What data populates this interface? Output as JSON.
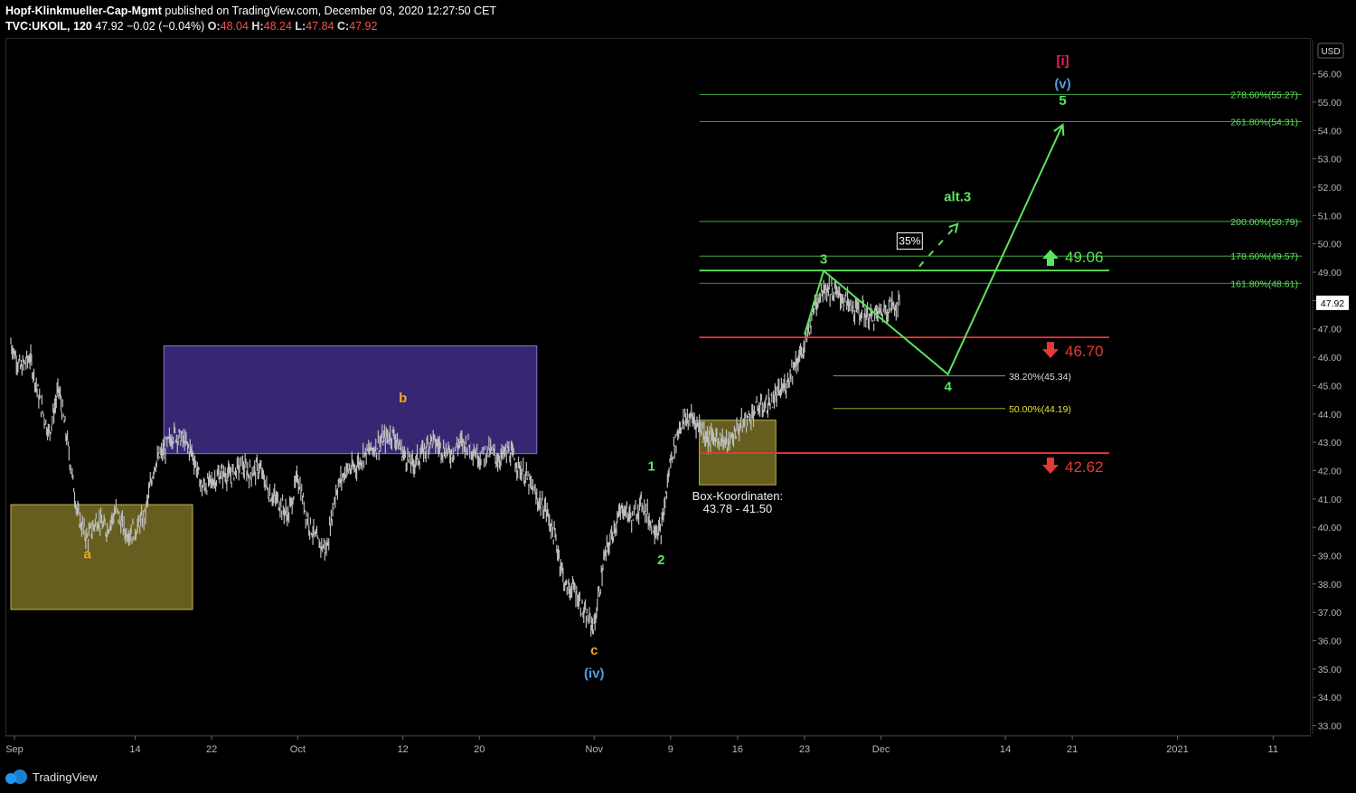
{
  "header": {
    "author": "Hopf-Klinkmueller-Cap-Mgmt",
    "published": "published on TradingView.com, December 03, 2020 12:27:50 CET",
    "symbol": "TVC:UKOIL, 120",
    "last": "47.92",
    "change": "−0.02 (−0.04%)",
    "o_label": "O:",
    "o_value": "48.04",
    "h_label": "H:",
    "h_value": "48.24",
    "l_label": "L:",
    "l_value": "47.84",
    "c_label": "C:",
    "c_value": "47.92"
  },
  "footer": {
    "brand": "TradingView"
  },
  "colors": {
    "background": "#000000",
    "candle": "#bdbdbd",
    "wave_green": "#5ee35e",
    "red_line": "#e53935",
    "orange": "#f5a623",
    "blue": "#4f9fe8",
    "magenta": "#e91e63",
    "olive_box": "#6b6420",
    "purple_box": "#3a2a7a"
  },
  "chart_data": {
    "type": "candlestick",
    "symbol": "TVC:UKOIL",
    "currency": "USD",
    "last_price": 47.92,
    "y_range": [
      32.7,
      57.2
    ],
    "y_ticks": [
      33,
      34,
      35,
      36,
      37,
      38,
      39,
      40,
      41,
      42,
      43,
      44,
      45,
      46,
      47,
      48,
      49,
      50,
      51,
      52,
      53,
      54,
      55,
      56
    ],
    "x_range": [
      "2020-09-01",
      "2021-01-14"
    ],
    "x_ticks": [
      {
        "label": "Sep",
        "date": "2020-09-01"
      },
      {
        "label": "14",
        "date": "2020-09-14"
      },
      {
        "label": "22",
        "date": "2020-09-22"
      },
      {
        "label": "Oct",
        "date": "2020-10-01"
      },
      {
        "label": "12",
        "date": "2020-10-12"
      },
      {
        "label": "20",
        "date": "2020-10-20"
      },
      {
        "label": "Nov",
        "date": "2020-11-01"
      },
      {
        "label": "9",
        "date": "2020-11-09"
      },
      {
        "label": "16",
        "date": "2020-11-16"
      },
      {
        "label": "23",
        "date": "2020-11-23"
      },
      {
        "label": "Dec",
        "date": "2020-12-01"
      },
      {
        "label": "14",
        "date": "2020-12-14"
      },
      {
        "label": "21",
        "date": "2020-12-21"
      },
      {
        "label": "2021",
        "date": "2021-01-01"
      },
      {
        "label": "11",
        "date": "2021-01-11"
      }
    ],
    "price_path": [
      [
        "2020-09-01",
        46.5
      ],
      [
        "2020-09-02",
        45.6
      ],
      [
        "2020-09-03",
        46.0
      ],
      [
        "2020-09-04",
        44.5
      ],
      [
        "2020-09-05",
        43.3
      ],
      [
        "2020-09-06",
        44.9
      ],
      [
        "2020-09-07",
        42.8
      ],
      [
        "2020-09-08",
        40.4
      ],
      [
        "2020-09-09",
        39.6
      ],
      [
        "2020-09-10",
        40.3
      ],
      [
        "2020-09-11",
        39.9
      ],
      [
        "2020-09-12",
        40.6
      ],
      [
        "2020-09-13",
        39.8
      ],
      [
        "2020-09-14",
        39.9
      ],
      [
        "2020-09-15",
        40.4
      ],
      [
        "2020-09-16",
        42.2
      ],
      [
        "2020-09-17",
        42.7
      ],
      [
        "2020-09-18",
        43.3
      ],
      [
        "2020-09-19",
        43.1
      ],
      [
        "2020-09-20",
        42.6
      ],
      [
        "2020-09-21",
        41.4
      ],
      [
        "2020-09-22",
        41.6
      ],
      [
        "2020-09-23",
        41.9
      ],
      [
        "2020-09-24",
        41.8
      ],
      [
        "2020-09-25",
        42.2
      ],
      [
        "2020-09-26",
        41.9
      ],
      [
        "2020-09-27",
        42.1
      ],
      [
        "2020-09-28",
        41.2
      ],
      [
        "2020-09-29",
        40.9
      ],
      [
        "2020-09-30",
        40.4
      ],
      [
        "2020-10-01",
        41.8
      ],
      [
        "2020-10-02",
        40.3
      ],
      [
        "2020-10-03",
        39.5
      ],
      [
        "2020-10-04",
        39.2
      ],
      [
        "2020-10-05",
        41.3
      ],
      [
        "2020-10-06",
        42.0
      ],
      [
        "2020-10-07",
        42.1
      ],
      [
        "2020-10-08",
        42.6
      ],
      [
        "2020-10-09",
        42.8
      ],
      [
        "2020-10-10",
        43.1
      ],
      [
        "2020-10-11",
        43.3
      ],
      [
        "2020-10-12",
        42.6
      ],
      [
        "2020-10-13",
        42.2
      ],
      [
        "2020-10-14",
        42.6
      ],
      [
        "2020-10-15",
        43.1
      ],
      [
        "2020-10-16",
        42.8
      ],
      [
        "2020-10-17",
        42.6
      ],
      [
        "2020-10-18",
        43.0
      ],
      [
        "2020-10-19",
        42.9
      ],
      [
        "2020-10-20",
        42.5
      ],
      [
        "2020-10-21",
        42.7
      ],
      [
        "2020-10-22",
        42.4
      ],
      [
        "2020-10-23",
        42.7
      ],
      [
        "2020-10-24",
        42.2
      ],
      [
        "2020-10-25",
        41.7
      ],
      [
        "2020-10-26",
        41.0
      ],
      [
        "2020-10-27",
        40.6
      ],
      [
        "2020-10-28",
        39.5
      ],
      [
        "2020-10-29",
        37.9
      ],
      [
        "2020-10-30",
        37.8
      ],
      [
        "2020-10-31",
        36.9
      ],
      [
        "2020-11-01",
        36.5
      ],
      [
        "2020-11-02",
        38.8
      ],
      [
        "2020-11-03",
        39.9
      ],
      [
        "2020-11-04",
        40.7
      ],
      [
        "2020-11-05",
        40.3
      ],
      [
        "2020-11-06",
        40.9
      ],
      [
        "2020-11-07",
        40.1
      ],
      [
        "2020-11-08",
        39.8
      ],
      [
        "2020-11-09",
        42.4
      ],
      [
        "2020-11-10",
        43.6
      ],
      [
        "2020-11-11",
        43.9
      ],
      [
        "2020-11-12",
        43.6
      ],
      [
        "2020-11-13",
        43.1
      ],
      [
        "2020-11-14",
        43.2
      ],
      [
        "2020-11-15",
        42.9
      ],
      [
        "2020-11-16",
        43.5
      ],
      [
        "2020-11-17",
        43.8
      ],
      [
        "2020-11-18",
        44.2
      ],
      [
        "2020-11-19",
        44.3
      ],
      [
        "2020-11-20",
        44.6
      ],
      [
        "2020-11-21",
        45.0
      ],
      [
        "2020-11-22",
        45.8
      ],
      [
        "2020-11-23",
        46.3
      ],
      [
        "2020-11-24",
        47.8
      ],
      [
        "2020-11-25",
        48.5
      ],
      [
        "2020-11-26",
        48.3
      ],
      [
        "2020-11-27",
        48.1
      ],
      [
        "2020-11-28",
        47.7
      ],
      [
        "2020-11-29",
        47.6
      ],
      [
        "2020-11-30",
        47.4
      ],
      [
        "2020-12-01",
        47.6
      ],
      [
        "2020-12-02",
        47.8
      ],
      [
        "2020-12-03",
        47.92
      ]
    ],
    "boxes": [
      {
        "name": "wave-a-box",
        "x": [
          "2020-09-01",
          "2020-09-20"
        ],
        "y": [
          37.1,
          40.8
        ],
        "color": "#6b6420"
      },
      {
        "name": "wave-b-box",
        "x": [
          "2020-09-17",
          "2020-10-26"
        ],
        "y": [
          42.6,
          46.4
        ],
        "color": "#3a2a7a"
      },
      {
        "name": "koordinaten-box",
        "x": [
          "2020-11-12",
          "2020-11-20"
        ],
        "y": [
          41.5,
          43.78
        ],
        "color": "#6b6420"
      }
    ],
    "box_label": {
      "line1": "Box-Koordinaten:",
      "line2": "43.78 - 41.50"
    },
    "fib_levels": [
      {
        "label": "278.60%(55.27)",
        "price": 55.27,
        "color": "#5ee35e",
        "x_start": "2020-11-12"
      },
      {
        "label": "261.80%(54.31)",
        "price": 54.31,
        "color": "#5ee35e",
        "x_start": "2020-11-12"
      },
      {
        "label": "200.00%(50.79)",
        "price": 50.79,
        "color": "#5ee35e",
        "x_start": "2020-11-12"
      },
      {
        "label": "178.60%(49.57)",
        "price": 49.57,
        "color": "#5ee35e",
        "x_start": "2020-11-12"
      },
      {
        "label": "161.80%(48.61)",
        "price": 48.61,
        "color": "#5ee35e",
        "x_start": "2020-11-12"
      },
      {
        "label": "38.20%(45.34)",
        "price": 45.34,
        "color": "#dddddd",
        "x_start": "2020-11-26"
      },
      {
        "label": "50.00%(44.19)",
        "price": 44.19,
        "color": "#e6e637",
        "x_start": "2020-11-26"
      }
    ],
    "levels": [
      {
        "price": 49.06,
        "label": "49.06",
        "direction": "up",
        "color": "#5ee35e"
      },
      {
        "price": 46.7,
        "label": "46.70",
        "direction": "down",
        "color": "#e53935"
      },
      {
        "price": 42.62,
        "label": "42.62",
        "direction": "down",
        "color": "#e53935"
      }
    ],
    "wave_path": [
      [
        "2020-11-23",
        46.8
      ],
      [
        "2020-11-25",
        49.05
      ],
      [
        "2020-12-08",
        45.4
      ],
      [
        "2020-12-20",
        54.2
      ]
    ],
    "alt_path": [
      [
        "2020-12-05",
        49.2
      ],
      [
        "2020-12-09",
        50.7
      ]
    ],
    "wave_labels": [
      {
        "text": "a",
        "date": "2020-09-09",
        "price": 38.9,
        "color": "#f5a623"
      },
      {
        "text": "b",
        "date": "2020-10-12",
        "price": 44.4,
        "color": "#f5a623"
      },
      {
        "text": "c",
        "date": "2020-11-01",
        "price": 35.5,
        "color": "#f5a623"
      },
      {
        "text": "(iv)",
        "date": "2020-11-01",
        "price": 34.7,
        "color": "#4f9fe8"
      },
      {
        "text": "1",
        "date": "2020-11-07",
        "price": 42.0,
        "color": "#5ee35e"
      },
      {
        "text": "2",
        "date": "2020-11-08",
        "price": 38.7,
        "color": "#5ee35e"
      },
      {
        "text": "3",
        "date": "2020-11-25",
        "price": 49.3,
        "color": "#5ee35e"
      },
      {
        "text": "4",
        "date": "2020-12-08",
        "price": 44.8,
        "color": "#5ee35e"
      },
      {
        "text": "5",
        "date": "2020-12-20",
        "price": 54.9,
        "color": "#5ee35e"
      },
      {
        "text": "(v)",
        "date": "2020-12-20",
        "price": 55.5,
        "color": "#4f9fe8"
      },
      {
        "text": "[i]",
        "date": "2020-12-20",
        "price": 56.3,
        "color": "#e91e63"
      },
      {
        "text": "alt.3",
        "date": "2020-12-09",
        "price": 51.5,
        "color": "#5ee35e"
      }
    ],
    "badge": {
      "text": "35%",
      "date": "2020-12-04",
      "price": 50.1
    }
  }
}
